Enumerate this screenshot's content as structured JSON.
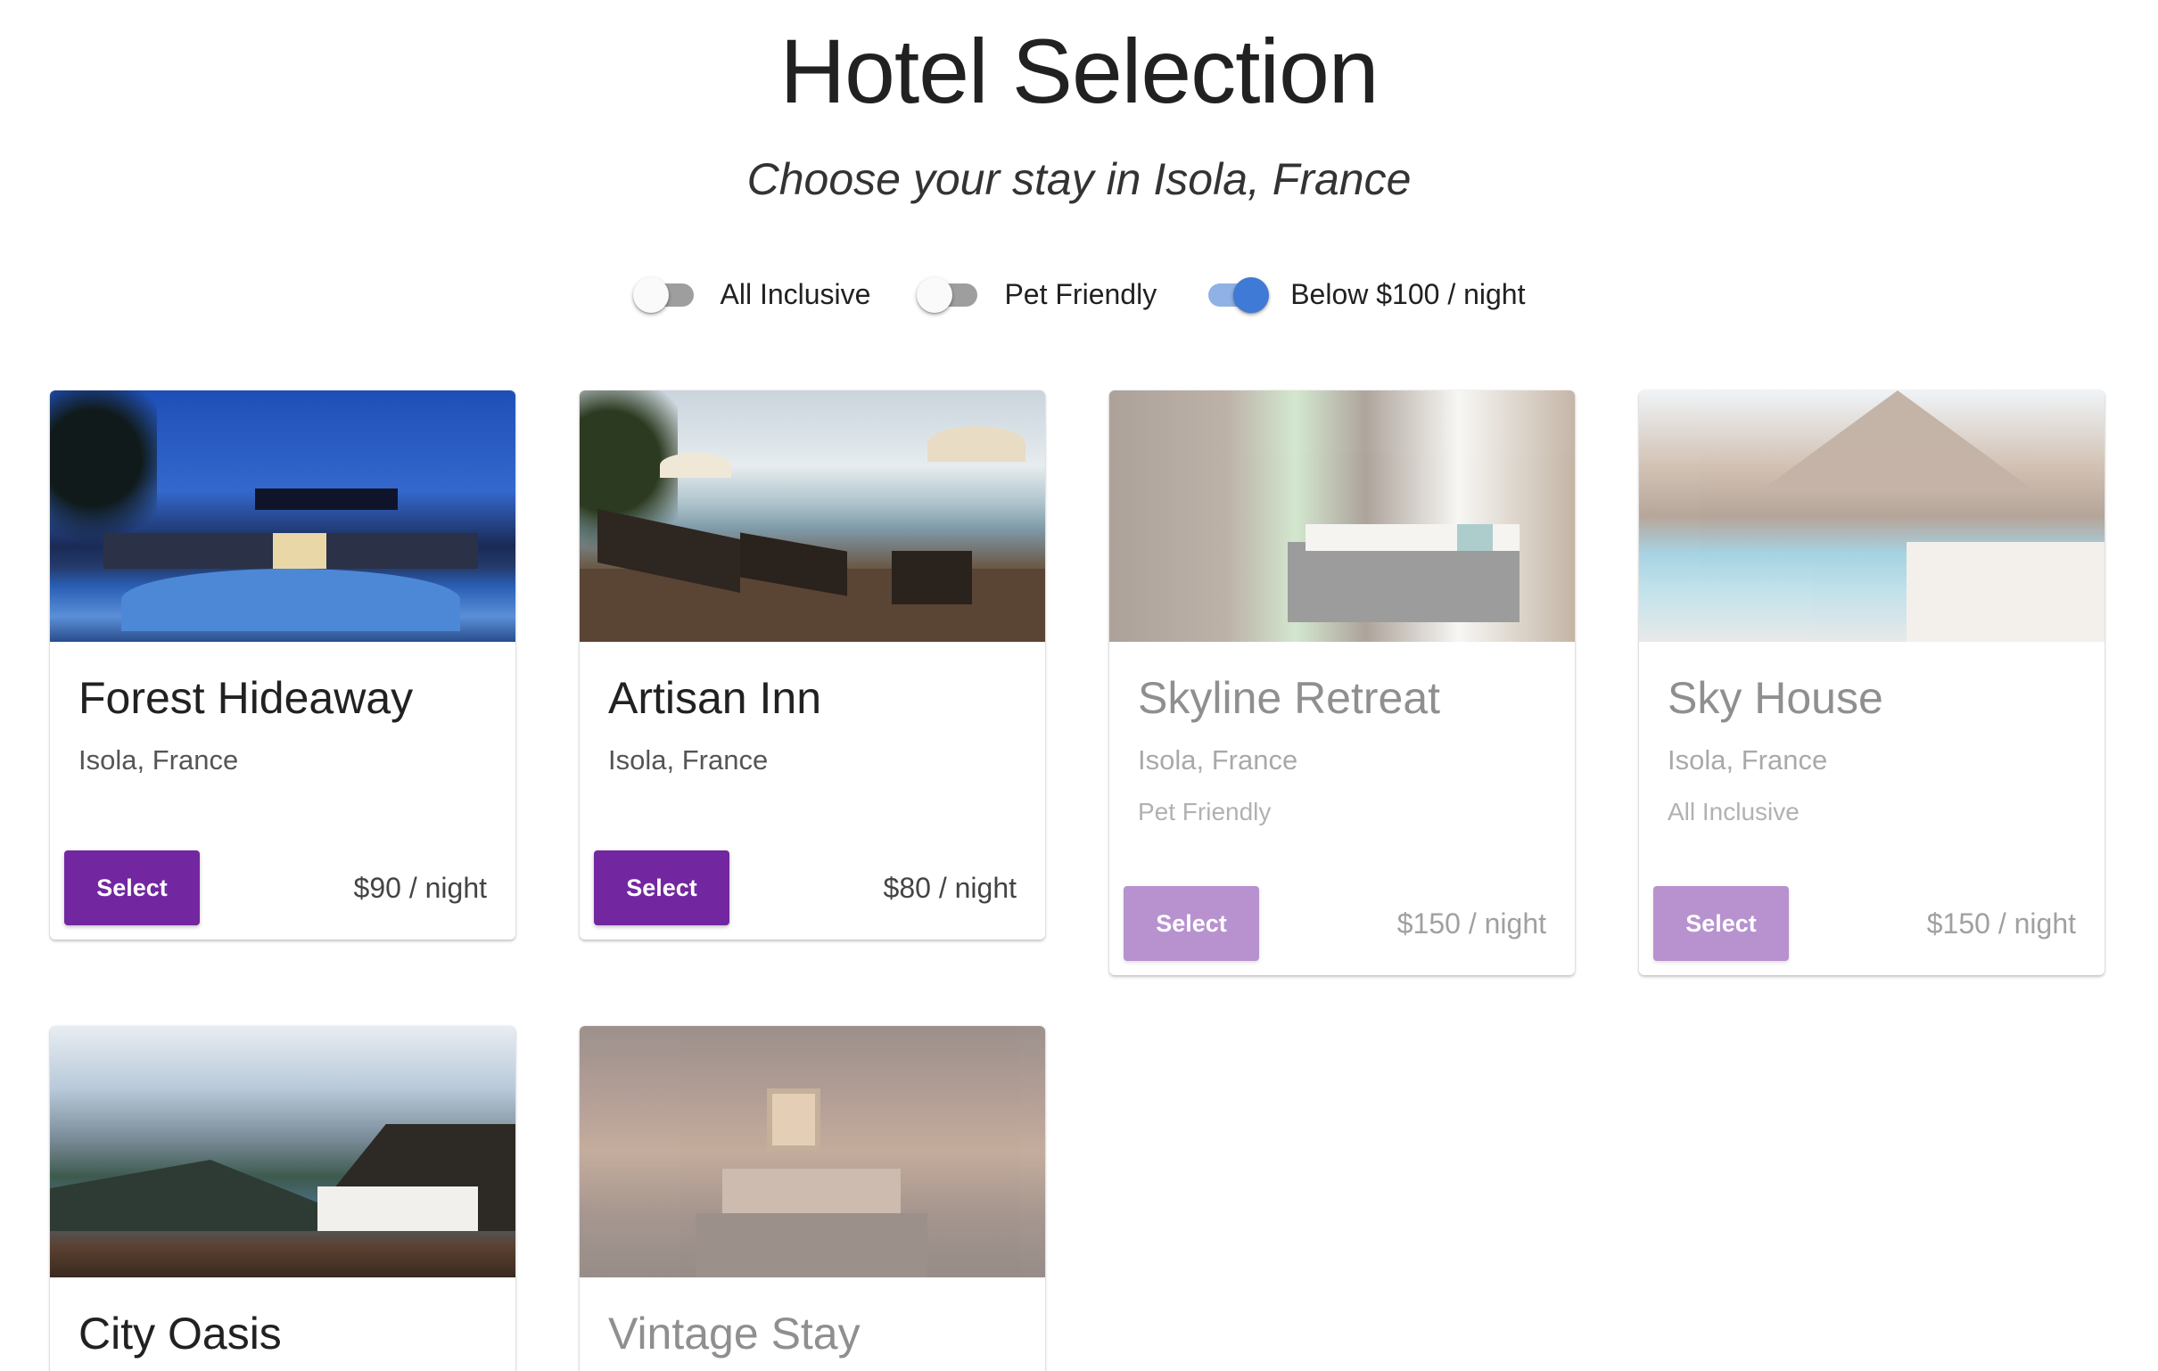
{
  "header": {
    "title": "Hotel Selection",
    "subtitle": "Choose your stay in Isola, France"
  },
  "filters": [
    {
      "label": "All Inclusive",
      "on": false
    },
    {
      "label": "Pet Friendly",
      "on": false
    },
    {
      "label": "Below $100 / night",
      "on": true
    }
  ],
  "colors": {
    "accent": "#7227a0",
    "toggle_on": "#3f7ad6",
    "toggle_track_on": "#90b1e6",
    "toggle_track_off": "#9e9e9e"
  },
  "hotels": [
    {
      "name": "Forest Hideaway",
      "location": "Isola, France",
      "tag": "",
      "price": "$90 / night",
      "button": "Select",
      "available": true
    },
    {
      "name": "Artisan Inn",
      "location": "Isola, France",
      "tag": "",
      "price": "$80 / night",
      "button": "Select",
      "available": true
    },
    {
      "name": "Skyline Retreat",
      "location": "Isola, France",
      "tag": "Pet Friendly",
      "price": "$150 / night",
      "button": "Select",
      "available": false
    },
    {
      "name": "Sky House",
      "location": "Isola, France",
      "tag": "All Inclusive",
      "price": "$150 / night",
      "button": "Select",
      "available": false
    },
    {
      "name": "City Oasis",
      "location": "",
      "tag": "",
      "price": "",
      "button": "",
      "available": true
    },
    {
      "name": "Vintage Stay",
      "location": "",
      "tag": "",
      "price": "",
      "button": "",
      "available": false
    }
  ]
}
